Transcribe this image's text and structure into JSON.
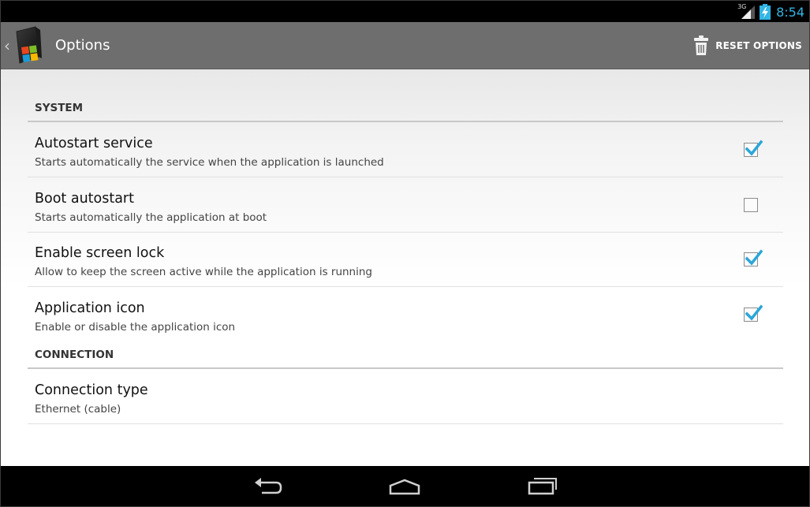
{
  "status_bar": {
    "network_label": "3G",
    "time": "8:54"
  },
  "action_bar": {
    "title": "Options",
    "reset_button_label": "RESET OPTIONS",
    "icons": {
      "up": "chevron-left-icon",
      "app": "app-logo-icon",
      "reset": "trash-icon"
    }
  },
  "sections": [
    {
      "title": "SYSTEM",
      "preferences": [
        {
          "title": "Autostart service",
          "summary": "Starts automatically the service when the application is launched",
          "checked": true
        },
        {
          "title": "Boot autostart",
          "summary": "Starts automatically the application at boot",
          "checked": false
        },
        {
          "title": "Enable screen lock",
          "summary": "Allow to keep the screen active while the application is running",
          "checked": true
        },
        {
          "title": "Application icon",
          "summary": "Enable or disable the application icon",
          "checked": true
        }
      ]
    },
    {
      "title": "CONNECTION",
      "preferences": [
        {
          "title": "Connection type",
          "summary": "Ethernet (cable)"
        }
      ]
    }
  ],
  "nav_bar": {
    "buttons": [
      "back-icon",
      "home-icon",
      "recents-icon"
    ]
  },
  "colors": {
    "accent": "#33b5e5",
    "action_bar": "#6e6e6e",
    "check": "#2aa6d8"
  }
}
